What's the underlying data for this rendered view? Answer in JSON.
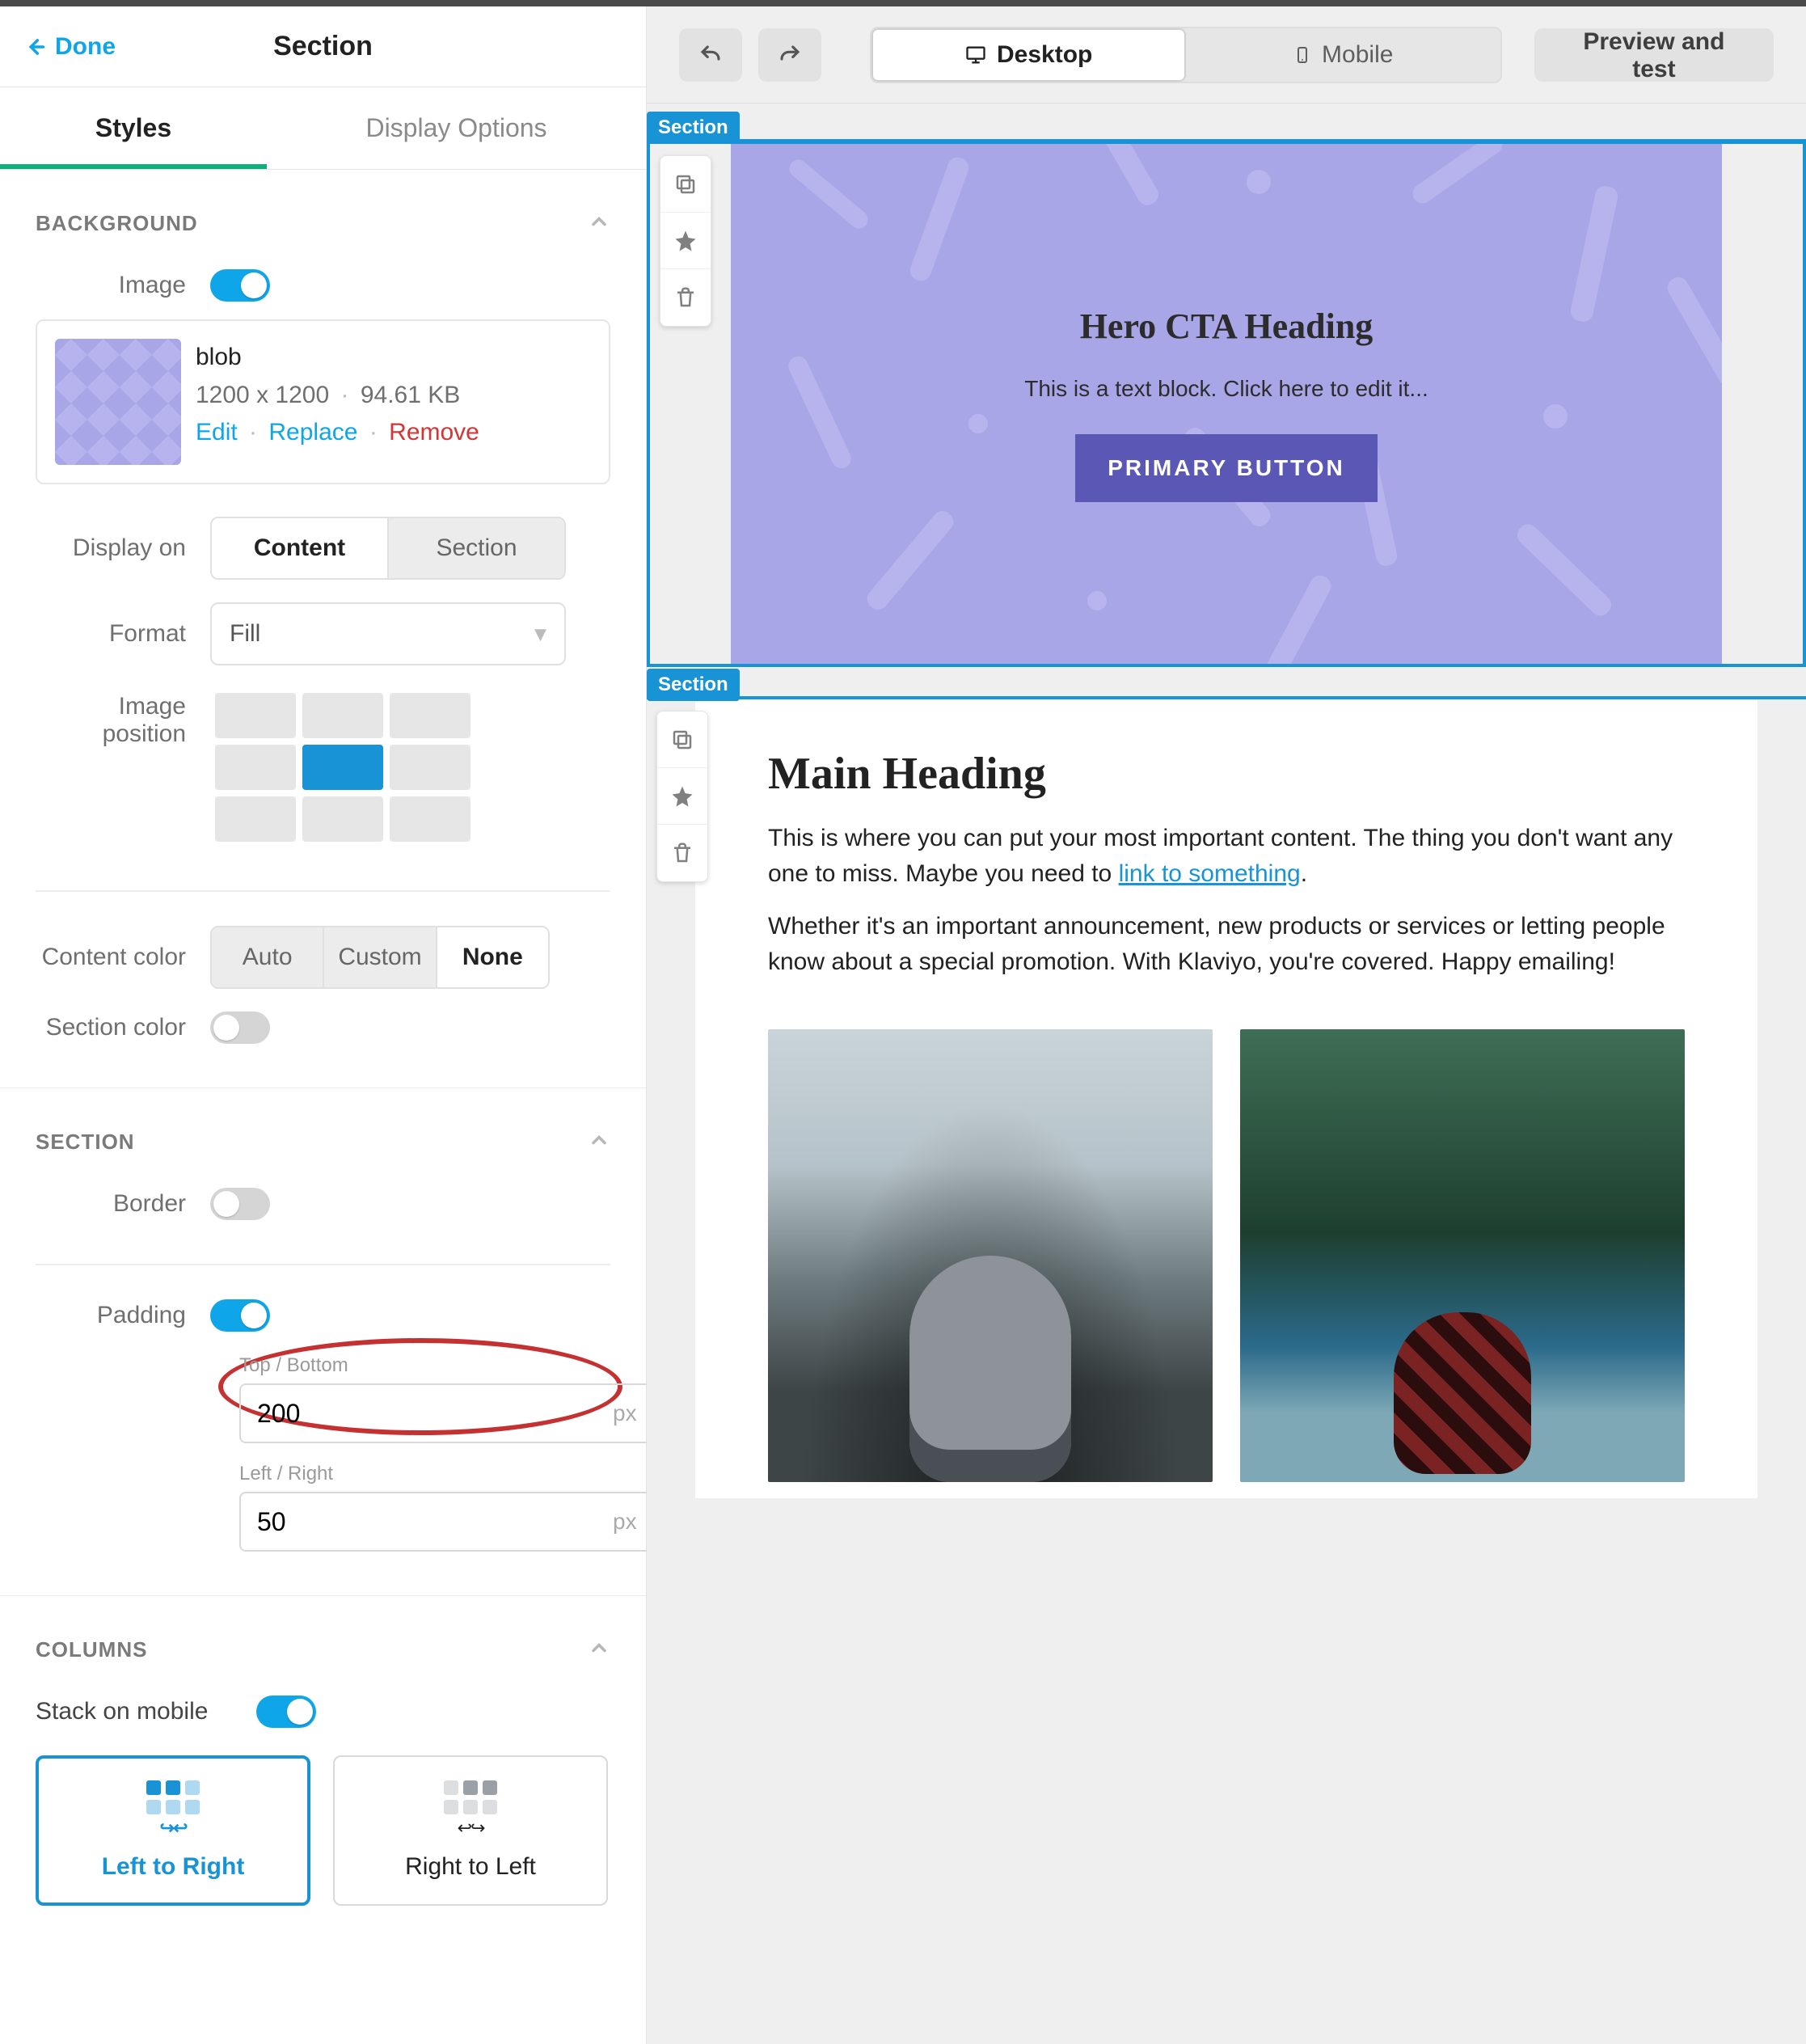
{
  "header": {
    "done": "Done",
    "title": "Section"
  },
  "tabs": {
    "styles": "Styles",
    "display_options": "Display Options"
  },
  "background": {
    "title": "BACKGROUND",
    "image_label": "Image",
    "file": {
      "name": "blob",
      "dims": "1200 x 1200",
      "size": "94.61 KB"
    },
    "links": {
      "edit": "Edit",
      "replace": "Replace",
      "remove": "Remove"
    },
    "display_on": {
      "label": "Display on",
      "content": "Content",
      "section": "Section"
    },
    "format": {
      "label": "Format",
      "value": "Fill"
    },
    "image_position_label": "Image position",
    "content_color": {
      "label": "Content color",
      "auto": "Auto",
      "custom": "Custom",
      "none": "None"
    },
    "section_color_label": "Section color"
  },
  "section_panel": {
    "title": "SECTION",
    "border_label": "Border",
    "padding_label": "Padding",
    "top_bottom": {
      "label": "Top / Bottom",
      "value": "200",
      "unit": "px"
    },
    "left_right": {
      "label": "Left / Right",
      "value": "50",
      "unit": "px"
    }
  },
  "columns_panel": {
    "title": "COLUMNS",
    "stack_label": "Stack on mobile",
    "ltr": "Left to Right",
    "rtl": "Right to Left"
  },
  "toolbar": {
    "desktop": "Desktop",
    "mobile": "Mobile",
    "preview": "Preview and test"
  },
  "section_tag": "Section",
  "hero": {
    "heading": "Hero CTA Heading",
    "text": "This is a text block. Click here to edit it...",
    "button": "PRIMARY BUTTON"
  },
  "main": {
    "heading": "Main Heading",
    "p1a": "This is where you can put your most important content. The thing you don't want any one to miss. Maybe you need to ",
    "p1_link": "link to something",
    "p1b": ".",
    "p2": "Whether it's an important announcement, new products or services or letting people know about a special promotion. With Klaviyo, you're covered. Happy emailing!"
  }
}
